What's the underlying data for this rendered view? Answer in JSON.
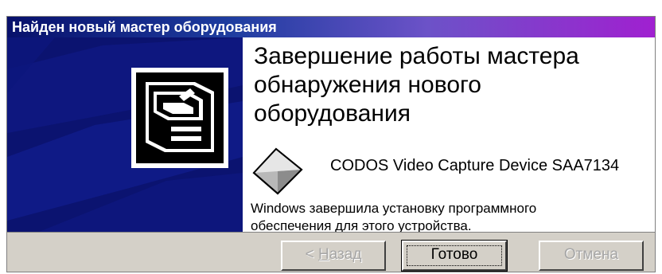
{
  "window": {
    "title": "Найден новый мастер оборудования"
  },
  "heading": {
    "line1": "Завершение работы мастера",
    "line2": "обнаружения нового",
    "line3": "оборудования"
  },
  "device": {
    "name": "CODOS Video Capture Device SAA7134",
    "icon": "device-diamond-icon"
  },
  "message": {
    "line1": "Windows завершила установку программного",
    "line2": "обеспечения для этого устройства."
  },
  "buttons": {
    "back": {
      "prefix": "< ",
      "mnemonic": "Н",
      "rest": "азад",
      "enabled": false
    },
    "finish": {
      "label": "Готово",
      "default": true
    },
    "cancel": {
      "label": "Отмена",
      "enabled": false
    }
  },
  "colors": {
    "titlebar_start": "#08106b",
    "titlebar_end": "#a020d0",
    "sidebar": "#0b1370",
    "dialog_face": "#d4d0c8"
  },
  "sidebar": {
    "icon": "hardware-wizard-icon"
  }
}
